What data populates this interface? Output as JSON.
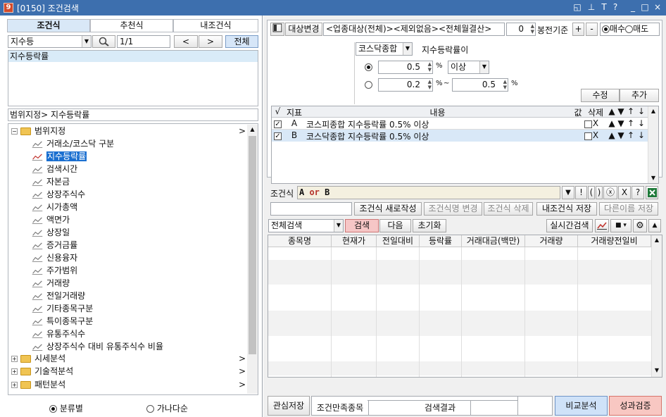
{
  "window": {
    "title": "[0150] 조건검색",
    "icon_text": "9",
    "controls": [
      "◱",
      "⊥",
      "T",
      "?",
      "_",
      "□",
      "×"
    ]
  },
  "left": {
    "tabs": [
      {
        "label": "조건식",
        "active": true
      },
      {
        "label": "추천식",
        "active": false
      },
      {
        "label": "내조건식",
        "active": false
      }
    ],
    "category_select": "지수등",
    "page_indicator": "1/1",
    "prev_label": "<",
    "next_label": ">",
    "all_label": "전체",
    "selected_list": [
      "지수등락률"
    ],
    "path_label": "범위지정> 지수등락률",
    "tree": {
      "root_label": "범위지정",
      "children": [
        {
          "label": "거래소/코스닥 구분",
          "selected": false
        },
        {
          "label": "지수등락률",
          "selected": true
        },
        {
          "label": "검색시간",
          "selected": false
        },
        {
          "label": "자본금",
          "selected": false
        },
        {
          "label": "상장주식수",
          "selected": false
        },
        {
          "label": "시가총액",
          "selected": false
        },
        {
          "label": "액면가",
          "selected": false
        },
        {
          "label": "상장일",
          "selected": false
        },
        {
          "label": "증거금률",
          "selected": false
        },
        {
          "label": "신용융자",
          "selected": false
        },
        {
          "label": "주가범위",
          "selected": false
        },
        {
          "label": "거래량",
          "selected": false
        },
        {
          "label": "전일거래량",
          "selected": false
        },
        {
          "label": "기타종목구분",
          "selected": false
        },
        {
          "label": "특이종목구분",
          "selected": false
        },
        {
          "label": "유통주식수",
          "selected": false
        },
        {
          "label": "상장주식수 대비 유통주식수 비율",
          "selected": false
        }
      ],
      "collapsed": [
        "시세분석",
        "기술적분석",
        "패턴분석"
      ]
    },
    "sort_options": [
      {
        "label": "분류별",
        "checked": true
      },
      {
        "label": "가나다순",
        "checked": false
      }
    ]
  },
  "right": {
    "target_change_label": "대상변경",
    "target_text": "<업종대상(전체)><제외없음><전체월결산>",
    "bong_value": "0",
    "bong_label": "봉전기준",
    "plus": "+",
    "minus": "-",
    "trade_options": [
      {
        "label": "매수",
        "checked": true
      },
      {
        "label": "매도",
        "checked": false
      }
    ],
    "market_select": "코스닥종합",
    "indicator_label": "지수등락률이",
    "option1": {
      "value": "0.5",
      "unit": "%",
      "compare": "이상",
      "checked": true
    },
    "option2": {
      "from": "0.2",
      "unit": "%",
      "tilde": "~",
      "to": "0.5",
      "unit2": "%",
      "checked": false
    },
    "edit_label": "수정",
    "add_label": "추가",
    "cond_table": {
      "headers": [
        "√",
        "지표",
        "내용",
        "값",
        "삭제",
        "▲",
        "▼",
        "↑",
        "↓"
      ],
      "rows": [
        {
          "checked": true,
          "id": "A",
          "content": "코스피종합 지수등락률 0.5% 이상",
          "delete": "X",
          "up": "▲",
          "down": "▼",
          "top": "↑",
          "bottom": "↓",
          "selected": false
        },
        {
          "checked": true,
          "id": "B",
          "content": "코스닥종합 지수등락률 0.5% 이상",
          "delete": "X",
          "up": "▲",
          "down": "▼",
          "top": "↑",
          "bottom": "↓",
          "selected": true
        }
      ]
    },
    "formula_label": "조건식",
    "formula_parts": [
      "A",
      " or ",
      "B"
    ],
    "formula_buttons": [
      "▼",
      "!",
      "(",
      ")",
      "ⓧ",
      "X",
      "?"
    ],
    "action_buttons": [
      {
        "label": "조건식 새로작성",
        "enabled": true
      },
      {
        "label": "조건식명 변경",
        "enabled": false
      },
      {
        "label": "조건식 삭제",
        "enabled": false
      },
      {
        "label": "내조건식 저장",
        "enabled": true
      },
      {
        "label": "다른이름 저장",
        "enabled": false
      }
    ],
    "search_scope": "전체검색",
    "search_label": "검색",
    "next_label": "다음",
    "reset_label": "초기화",
    "realtime_label": "실시간검색",
    "result_headers": [
      "종목명",
      "현재가",
      "전일대비",
      "등락률",
      "거래대금(백만)",
      "거래량",
      "거래량전일비"
    ],
    "footer": {
      "interest_save": "관심저장",
      "satisfied_label": "조건만족종목",
      "result_label": "검색결과",
      "compare_label": "비교분석",
      "verify_label": "성과검증"
    }
  },
  "colors": {
    "title_bar": "#3d6fae",
    "selection": "#d9e8f7",
    "highlight": "#1a6fd0",
    "search_button": "#f6c6c6",
    "compare_button": "#cfe2f8",
    "verify_button": "#f8c7c2"
  }
}
